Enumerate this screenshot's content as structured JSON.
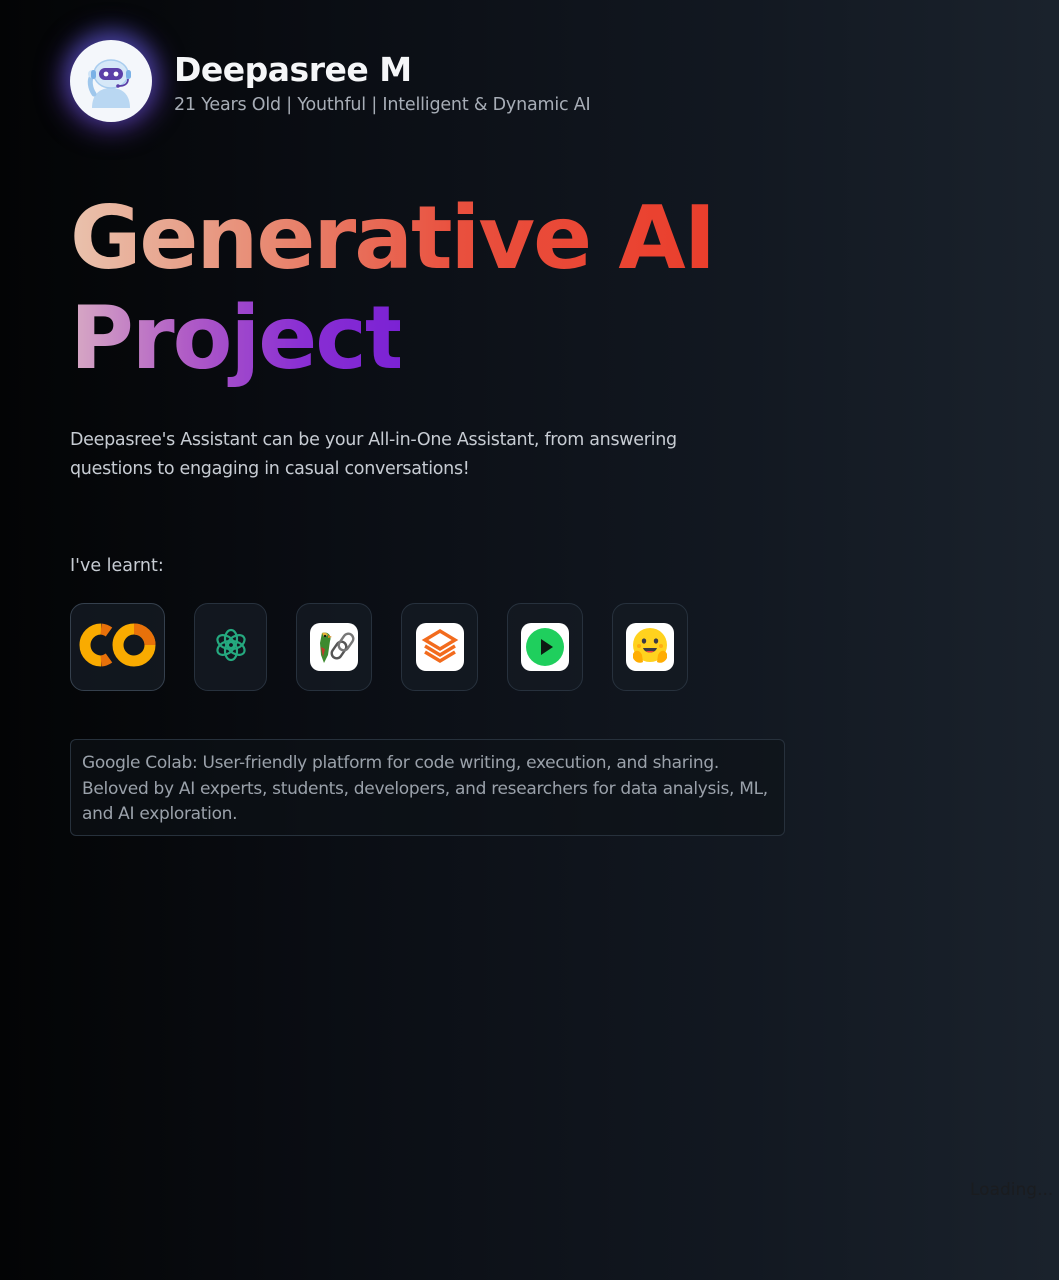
{
  "profile": {
    "name": "Deepasree M",
    "tagline": "21 Years Old | Youthful | Intelligent & Dynamic AI",
    "avatar_icon": "robot-assistant-icon"
  },
  "hero": {
    "title_line1": "Generative AI",
    "title_line2": "Project",
    "description": "Deepasree's Assistant can be your All-in-One Assistant, from answering questions to engaging in casual conversations!"
  },
  "learnt": {
    "label": "I've learnt:",
    "tools": [
      {
        "name": "Google Colab",
        "icon": "google-colab-icon",
        "selected": true
      },
      {
        "name": "OpenAI",
        "icon": "openai-icon",
        "selected": false
      },
      {
        "name": "LangChain",
        "icon": "langchain-icon",
        "selected": false
      },
      {
        "name": "Pinecone",
        "icon": "layers-icon",
        "selected": false
      },
      {
        "name": "Play",
        "icon": "play-icon",
        "selected": false
      },
      {
        "name": "Hugging Face",
        "icon": "hugging-face-icon",
        "selected": false
      }
    ]
  },
  "info": {
    "text": "Google Colab: User-friendly platform for code writing, execution, and sharing. Beloved by AI experts, students, developers, and researchers for data analysis, ML, and AI exploration."
  },
  "status": {
    "loading_text": "Loading..."
  },
  "colors": {
    "title_line1_gradient": [
      "#e9c2ad",
      "#ea3e2c"
    ],
    "title_line2_gradient": [
      "#d8aac4",
      "#7b22d4"
    ],
    "avatar_glow": "#7846dc"
  }
}
